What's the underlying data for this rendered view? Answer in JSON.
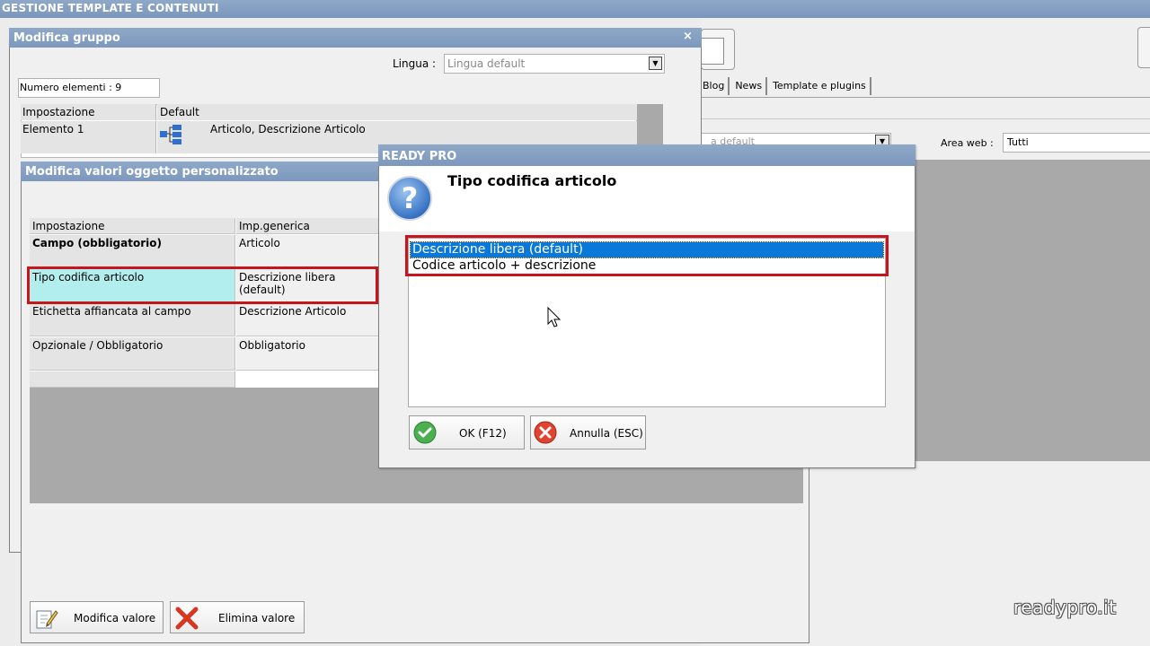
{
  "app": {
    "title": "GESTIONE TEMPLATE E CONTENUTI"
  },
  "background": {
    "tabs": [
      "Blog",
      "News",
      "Template e plugins"
    ],
    "lingua_value": "a default",
    "area_web_label": "Area web :",
    "area_web_value": "Tutti",
    "watermark": "readypro.it"
  },
  "gruppo_window": {
    "title": "Modifica gruppo",
    "close_glyph": "×",
    "lingua_label": "Lingua :",
    "lingua_value": "Lingua default",
    "numero_elementi": "Numero elementi : 9",
    "grid": {
      "headers": [
        "Impostazione",
        "Default"
      ],
      "rows": [
        {
          "name": "Elemento 1",
          "value": "Articolo, Descrizione Articolo"
        }
      ]
    }
  },
  "valori_window": {
    "title": "Modifica valori oggetto personalizzato",
    "grid": {
      "headers": [
        "Impostazione",
        "Imp.generica"
      ],
      "rows": [
        {
          "name": "Campo (obbligatorio)",
          "value": "Articolo",
          "bold": true
        },
        {
          "name": "Tipo codifica articolo",
          "value": "Descrizione libera (default)",
          "selected": true
        },
        {
          "name": "Etichetta affiancata al campo",
          "value": "Descrizione Articolo"
        },
        {
          "name": "Opzionale / Obbligatorio",
          "value": "Obbligatorio"
        }
      ]
    },
    "buttons": {
      "modifica": "Modifica valore",
      "elimina": "Elimina valore"
    }
  },
  "dialog": {
    "title": "READY PRO",
    "heading": "Tipo codifica articolo",
    "options": [
      {
        "label": "Descrizione libera (default)",
        "selected": true
      },
      {
        "label": "Codice articolo + descrizione",
        "selected": false
      }
    ],
    "buttons": {
      "ok": "OK (F12)",
      "cancel": "Annulla (ESC)"
    }
  },
  "colors": {
    "titlebar": "#8fa8c8",
    "highlight_border": "#c8151d",
    "selection": "#0a78d7",
    "row_selected": "#b2eeee"
  },
  "icons": [
    "tree-icon",
    "question-icon",
    "check-icon",
    "cancel-icon",
    "edit-icon",
    "delete-x-icon",
    "mouse-cursor-icon"
  ]
}
